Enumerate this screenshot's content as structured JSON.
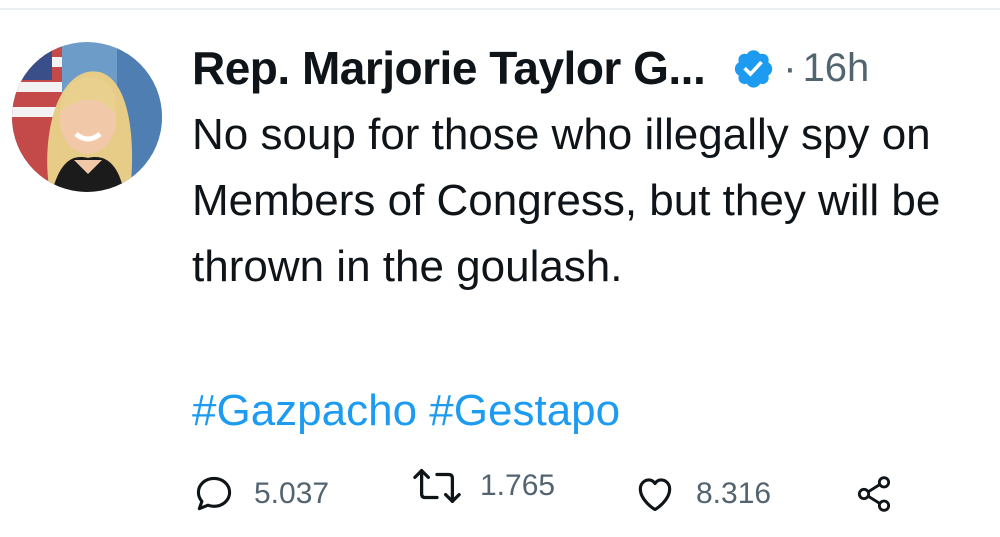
{
  "tweet": {
    "author_name": "Rep. Marjorie Taylor G...",
    "separator": "·",
    "timestamp": "16h",
    "text": "No soup for those who illegally spy on Members of Congress, but they will be thrown in the goulash.",
    "hashtags": [
      "#Gazpacho",
      "#Gestapo"
    ]
  },
  "actions": {
    "replies": "5.037",
    "retweets": "1.765",
    "likes": "8.316"
  },
  "icons": {
    "avatar": "profile-photo",
    "verified": "verified-badge-icon",
    "reply": "speech-bubble-icon",
    "retweet": "retweet-arrows-icon",
    "like": "heart-icon",
    "share": "share-nodes-icon"
  },
  "colors": {
    "link": "#1d9bf0",
    "verified": "#1d9bf0",
    "muted": "#536471",
    "text": "#0f1419"
  }
}
